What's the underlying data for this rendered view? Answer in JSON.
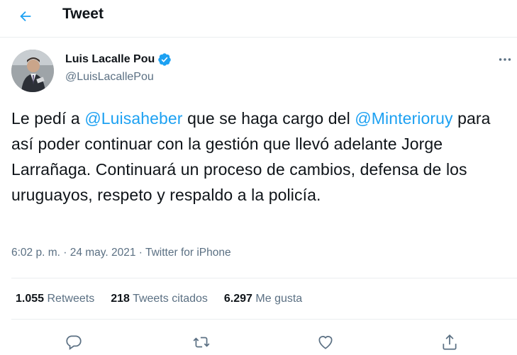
{
  "header": {
    "back_icon": "arrow-left-icon",
    "title": "Tweet"
  },
  "tweet": {
    "author": {
      "name": "Luis Lacalle Pou",
      "handle": "@LuisLacallePou",
      "verified_icon": "verified-badge-icon"
    },
    "text": {
      "p1": "Le pedí a ",
      "mention1": "@Luisaheber",
      "p2": " que se haga cargo del ",
      "mention2": "@Minterioruy",
      "p3": " para así poder continuar con la gestión que llevó adelante Jorge Larrañaga. Continuará un proceso de cambios, defensa de los uruguayos, respeto y respaldo a la policía."
    },
    "time": "6:02 p. m.",
    "separator": " · ",
    "date": "24 may. 2021",
    "source": "Twitter for iPhone",
    "stats": {
      "retweets_count": "1.055",
      "retweets_label": "Retweets",
      "quotes_count": "218",
      "quotes_label": "Tweets citados",
      "likes_count": "6.297",
      "likes_label": "Me gusta"
    }
  },
  "colors": {
    "accent": "#1da1f2",
    "verified": "#1da1f2",
    "secondary_text": "#5b7083",
    "divider": "#ebeef0"
  }
}
